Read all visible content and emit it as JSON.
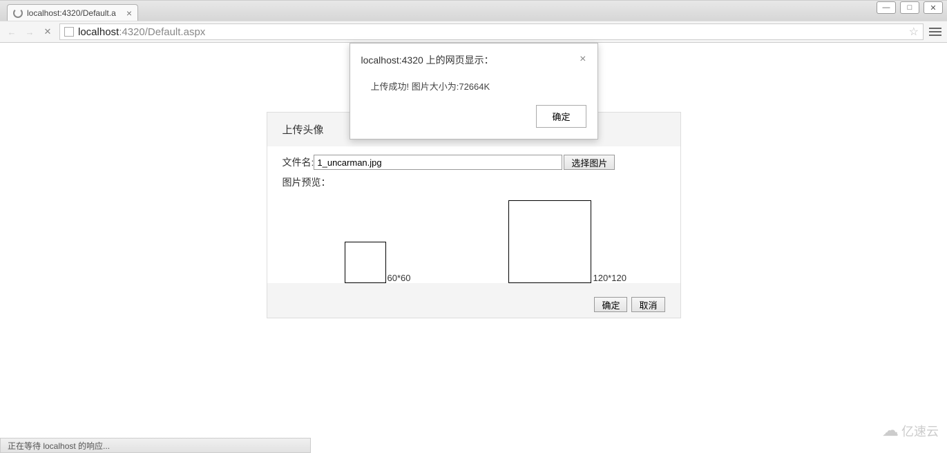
{
  "window": {
    "minimize_icon": "—",
    "maximize_icon": "□",
    "close_icon": "✕"
  },
  "tab": {
    "title": "localhost:4320/Default.a",
    "close_glyph": "×"
  },
  "nav": {
    "back_glyph": "←",
    "forward_glyph": "→",
    "stop_glyph": "✕",
    "url_host": "localhost",
    "url_path": ":4320/Default.aspx",
    "star_glyph": "☆"
  },
  "alert": {
    "title": "localhost:4320 上的网页显示：",
    "message": "上传成功! 图片大小为:72664K",
    "ok": "确定",
    "close_glyph": "×"
  },
  "panel": {
    "title": "上传头像",
    "filename_label": "文件名:",
    "filename_value": "1_uncarman.jpg",
    "choose_button": "选择图片",
    "preview_label": "图片预览：",
    "caption60": "60*60",
    "caption120": "120*120",
    "confirm": "确定",
    "cancel": "取消"
  },
  "status": {
    "text": "正在等待 localhost 的响应..."
  },
  "watermark": {
    "cloud_glyph": "☁",
    "text": "亿速云"
  }
}
